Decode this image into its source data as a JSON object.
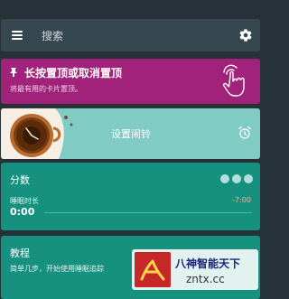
{
  "search": {
    "placeholder": "搜索",
    "menu_icon": "menu-icon",
    "settings_icon": "gear-icon"
  },
  "pin_card": {
    "title": "长按置顶或取消置顶",
    "subtitle": "将最有用的卡片置顶。",
    "icon": "pin-icon",
    "gesture_icon": "long-press-hand-icon",
    "color": "#a0227a"
  },
  "alarm_card": {
    "label": "设置闹铃",
    "icon": "alarm-clock-icon",
    "image": "coffee-cup-art",
    "color": "#80cbc4"
  },
  "score_card": {
    "title": "分数",
    "sleep_duration_label": "睡眠时长",
    "sleep_duration_value": "0:00",
    "sleep_target": "-7:00",
    "color": "#16907f"
  },
  "tutorial_card": {
    "title": "教程",
    "subtitle": "简单几步，开始使用睡眠追踪",
    "color": "#16907f"
  },
  "watermark": {
    "line1": "八神智能天下",
    "line2": "zntx.cc"
  }
}
